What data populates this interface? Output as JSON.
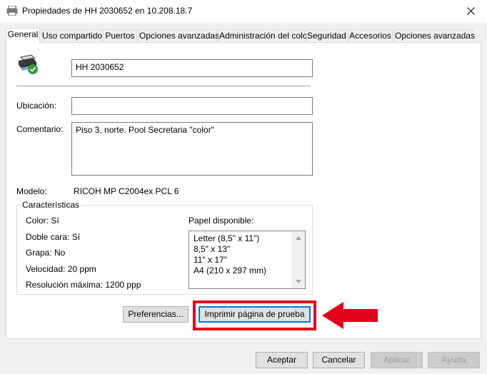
{
  "window": {
    "title": "Propiedades de HH 2030652 en 10.208.18.7"
  },
  "tabs": [
    {
      "label": "General"
    },
    {
      "label": "Uso compartido"
    },
    {
      "label": "Puertos"
    },
    {
      "label": "Opciones avanzadas"
    },
    {
      "label": "Administración del color"
    },
    {
      "label": "Seguridad"
    },
    {
      "label": "Accesorios"
    },
    {
      "label": "Opciones avanzadas"
    }
  ],
  "general": {
    "printer_name": "HH 2030652",
    "location_label": "Ubicación:",
    "location_value": "",
    "comment_label": "Comentario:",
    "comment_value": "Piso 3, norte. Pool Secretaria \"color\"",
    "model_label": "Modelo:",
    "model_value": "RICOH MP C2004ex PCL 6"
  },
  "features": {
    "title": "Características",
    "color": "Color: Sí",
    "duplex": "Doble cara: Sí",
    "staple": "Grapa: No",
    "speed": "Velocidad: 20 ppm",
    "resolution": "Resolución máxima: 1200 ppp",
    "paper_label": "Papel disponible:",
    "paper_list": [
      "Letter (8,5\" x 11\")",
      "8,5\" x 13\"",
      "11\" x 17\"",
      "A4 (210 x 297 mm)"
    ]
  },
  "buttons": {
    "preferences": "Preferencias...",
    "print_test": "Imprimir página de prueba",
    "accept": "Aceptar",
    "cancel": "Cancelar",
    "apply": "Aplicar",
    "help": "Ayuda"
  },
  "colors": {
    "highlight": "#e3001b",
    "focus": "#0078d7"
  },
  "icons": [
    "printer-icon",
    "close-icon",
    "printer-ready-icon",
    "red-arrow-icon"
  ]
}
